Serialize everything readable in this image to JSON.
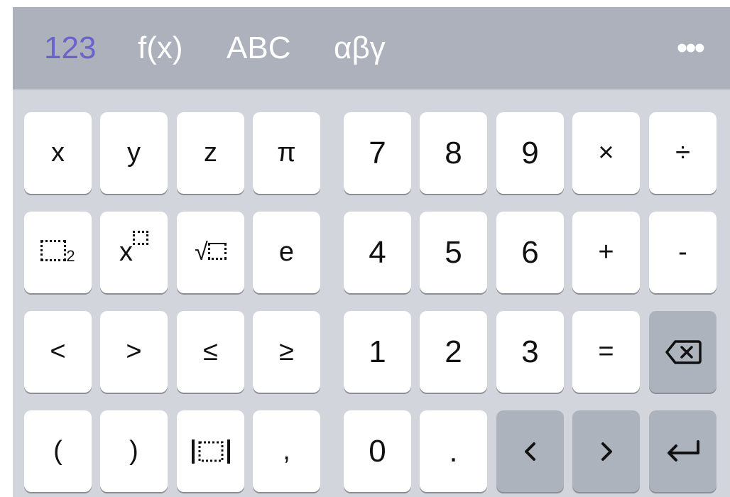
{
  "tabs": [
    {
      "label": "123",
      "active": true
    },
    {
      "label": "f(x)",
      "active": false
    },
    {
      "label": "ABC",
      "active": false
    },
    {
      "label": "αβγ",
      "active": false
    }
  ],
  "more_label": "•••",
  "keys": {
    "row1": [
      "x",
      "y",
      "z",
      "π",
      "7",
      "8",
      "9",
      "×",
      "÷"
    ],
    "row2": [
      "□²",
      "x^□",
      "√□",
      "e",
      "4",
      "5",
      "6",
      "+",
      "-"
    ],
    "row3": [
      "<",
      ">",
      "≤",
      "≥",
      "1",
      "2",
      "3",
      "=",
      "backspace"
    ],
    "row4": [
      "(",
      ")",
      "|□|",
      ",",
      "0",
      ".",
      "‹",
      "›",
      "enter"
    ]
  },
  "squared_superscript": "2",
  "x_base": "x",
  "root_sign": "√",
  "colors": {
    "accent": "#6a63cc",
    "tab_bar": "#acb1bb",
    "keyboard_bg": "#d2d5dc",
    "key_light": "#ffffff",
    "key_dark": "#adb3bd"
  }
}
